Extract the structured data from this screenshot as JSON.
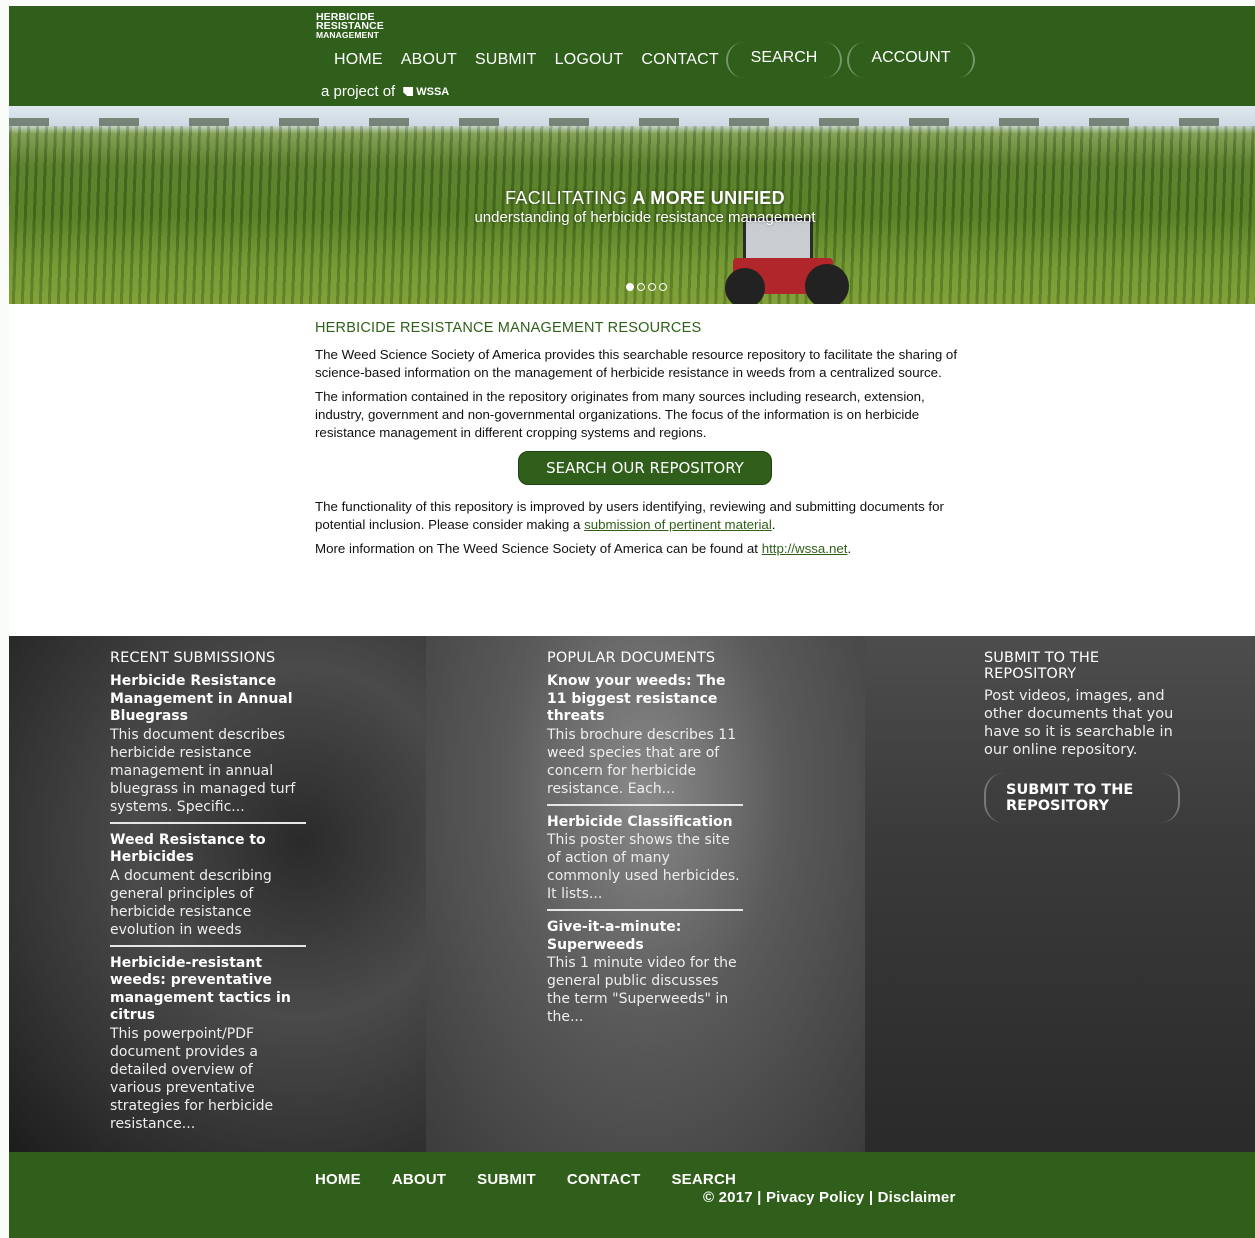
{
  "header": {
    "logo": [
      "HERBICIDE",
      "RESISTANCE",
      "MANAGEMENT"
    ],
    "nav": [
      "HOME",
      "ABOUT",
      "SUBMIT",
      "LOGOUT",
      "CONTACT"
    ],
    "search": "SEARCH",
    "account": "ACCOUNT",
    "project_text": "a project of",
    "project_logo": "WSSA"
  },
  "hero": {
    "line1_light": "FACILITATING",
    "line1_bold": "A MORE UNIFIED",
    "line2": "understanding of herbicide resistance management",
    "slides": 4,
    "active_slide": 1
  },
  "main": {
    "heading": "HERBICIDE RESISTANCE MANAGEMENT RESOURCES",
    "para1": "The Weed Science Society of America provides this searchable resource repository to facilitate the sharing of science-based information on the management of herbicide resistance in weeds from a centralized source.",
    "para2": "The information contained in the repository originates from many sources including research, extension, industry, government and non-governmental organizations.  The focus of the information is on herbicide resistance management in different cropping systems and regions.",
    "button": "SEARCH OUR REPOSITORY",
    "para3_a": "The functionality of this repository is improved by users identifying, reviewing and submitting documents for potential inclusion.  Please consider making a",
    "para3_link": "submission of pertinent material",
    "para3_b": ".",
    "para4_a": "More information on The Weed Science Society of America can be found at",
    "para4_link": "http://wssa.net",
    "para4_b": "."
  },
  "recent": {
    "heading": "RECENT SUBMISSIONS",
    "items": [
      {
        "title": "Herbicide Resistance Management in Annual Bluegrass",
        "desc": "This document describes herbicide resistance management in annual bluegrass in managed turf systems. Specific..."
      },
      {
        "title": "Weed Resistance to Herbicides",
        "desc": "A document describing general principles of herbicide resistance evolution in weeds"
      },
      {
        "title": "Herbicide-resistant weeds: preventative management tactics in citrus",
        "desc": "This powerpoint/PDF document provides a detailed overview of various preventative strategies for herbicide resistance..."
      }
    ]
  },
  "popular": {
    "heading": "POPULAR DOCUMENTS",
    "items": [
      {
        "title": "Know your weeds: The 11 biggest resistance threats",
        "desc": "This brochure describes 11 weed species that are of concern for herbicide resistance. Each..."
      },
      {
        "title": "Herbicide Classification",
        "desc": "This poster shows the site of action of many commonly used herbicides. It lists..."
      },
      {
        "title": "Give-it-a-minute: Superweeds",
        "desc": "This 1 minute video for the general public discusses the term \"Superweeds\" in the..."
      }
    ]
  },
  "submit": {
    "heading": "SUBMIT TO THE REPOSITORY",
    "text": "Post videos, images, and other documents that you have so it is searchable in our online repository.",
    "button": "SUBMIT TO THE REPOSITORY"
  },
  "footer": {
    "nav": [
      "HOME",
      "ABOUT",
      "SUBMIT",
      "CONTACT",
      "SEARCH"
    ],
    "copyright": "© 2017",
    "privacy": "Pivacy Policy",
    "disclaimer": "Disclaimer",
    "sep": "|"
  },
  "colors": {
    "brand_green": "#2f5f1a",
    "dark_section": "#3a3a3a"
  }
}
